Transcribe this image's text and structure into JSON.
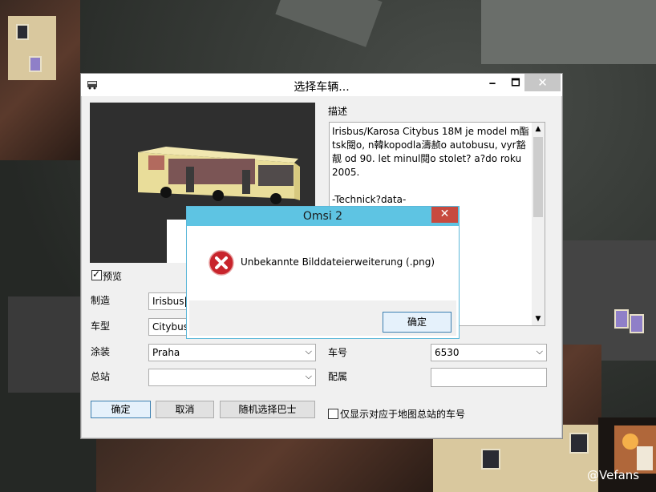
{
  "window": {
    "title": "选择车辆...",
    "minimize": "🗕",
    "maximize": "🗖",
    "close": "✕"
  },
  "vehicle": {
    "preview_checkbox_label": "预览",
    "preview_checked": true,
    "labels": {
      "manufacturer": "制造",
      "model": "车型",
      "livery": "涂装",
      "depot": "总站",
      "description": "描述",
      "number": "车号",
      "config": "配属"
    },
    "manufacturer_value": "Irisbus|I",
    "model_value": "Citybus",
    "livery_value": "Praha",
    "depot_value": "",
    "number_value": "6530",
    "config_value": "",
    "description_text": "Irisbus/Karosa Citybus 18M je model m酯tsk閱o, n韓kopodla濤赪o autobusu, vyr豁 靓 od 90. let minul閱o stolet? a?do roku 2005.\n\n-Technick?data-"
  },
  "buttons": {
    "ok": "确定",
    "cancel": "取消",
    "random": "随机选择巴士",
    "only_depot_checkbox": "仅显示对应于地图总站的车号",
    "only_depot_checked": false
  },
  "message_box": {
    "title": "Omsi 2",
    "close": "✕",
    "text": "Unbekannte Bilddateierweiterung (.png)",
    "ok": "确定",
    "icon": "error-icon"
  },
  "watermark": "@Vefans"
}
